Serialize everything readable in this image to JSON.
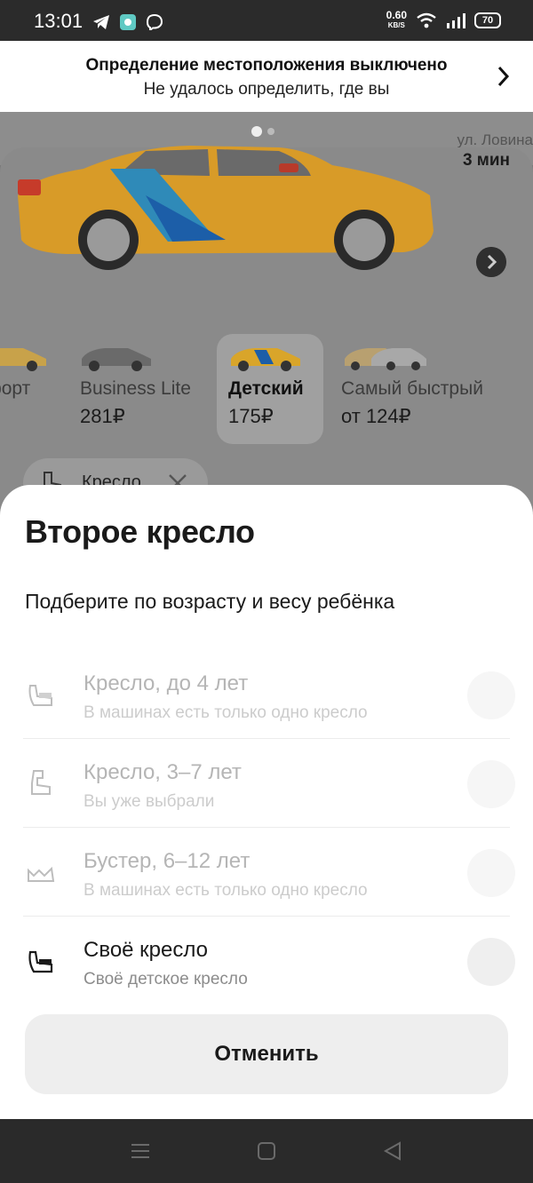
{
  "status_bar": {
    "time": "13:01",
    "net_speed": "0.60",
    "net_speed_unit": "KB/S",
    "battery": "70",
    "icons": [
      "telegram-icon",
      "app-icon",
      "viber-icon",
      "wifi-icon",
      "signal-icon",
      "battery-icon"
    ]
  },
  "location_banner": {
    "title": "Определение местоположения выключено",
    "subtitle": "Не удалось определить, где вы"
  },
  "map": {
    "street": "ул. Ловина"
  },
  "card": {
    "eta": "3 мин",
    "carousel_dots": 2
  },
  "tariffs": [
    {
      "name": "мфорт",
      "price": "₽"
    },
    {
      "name": "Business Lite",
      "price": "281₽"
    },
    {
      "name": "Детский",
      "price": "175₽",
      "selected": true
    },
    {
      "name": "Самый быстрый",
      "price": "от 124₽"
    }
  ],
  "chip": {
    "label": "Кресло"
  },
  "sheet": {
    "title": "Второе кресло",
    "subtitle": "Подберите по возрасту и весу ребёнка",
    "options": [
      {
        "title": "Кресло, до 4 лет",
        "subtitle": "В машинах есть только одно кресло",
        "enabled": false,
        "icon": "infant-seat-icon"
      },
      {
        "title": "Кресло, 3–7 лет",
        "subtitle": "Вы уже выбрали",
        "enabled": false,
        "icon": "child-seat-icon"
      },
      {
        "title": "Бустер, 6–12 лет",
        "subtitle": "В машинах есть только одно кресло",
        "enabled": false,
        "icon": "booster-icon"
      },
      {
        "title": "Своё кресло",
        "subtitle": "Своё детское кресло",
        "enabled": true,
        "icon": "own-seat-icon"
      }
    ],
    "cancel_label": "Отменить"
  },
  "nav_bar": {
    "buttons": [
      "menu-icon",
      "home-icon",
      "back-icon"
    ]
  },
  "colors": {
    "taxi_yellow": "#e2a52b",
    "taxi_blue": "#1c5ea8",
    "overlay_gray": "#7a7a7a"
  }
}
